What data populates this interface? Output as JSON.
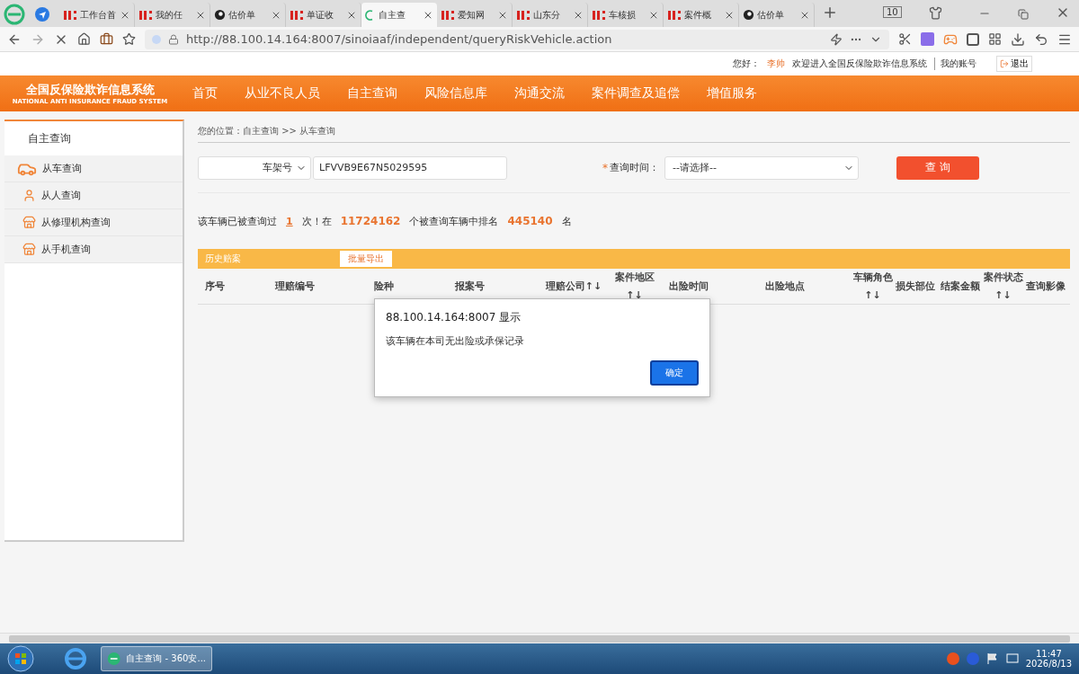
{
  "browser": {
    "tabs": [
      {
        "kind": "cic",
        "label": "工作台首",
        "selected": false
      },
      {
        "kind": "cic",
        "label": "我的任",
        "selected": false
      },
      {
        "kind": "calc",
        "label": "估价单",
        "selected": false
      },
      {
        "kind": "cic",
        "label": "单证收",
        "selected": false
      },
      {
        "kind": "loading",
        "label": "自主查",
        "selected": true
      },
      {
        "kind": "cic",
        "label": "爱知网",
        "selected": false
      },
      {
        "kind": "cic",
        "label": "山东分",
        "selected": false
      },
      {
        "kind": "cic",
        "label": "车核损",
        "selected": false
      },
      {
        "kind": "cic",
        "label": "案件概",
        "selected": false
      },
      {
        "kind": "calc",
        "label": "估价单",
        "selected": false
      }
    ],
    "tab_count": "10",
    "address": "http://88.100.14.164:8007/sinoiaaf/independent/queryRiskVehicle.action"
  },
  "header": {
    "greeting": "您好：",
    "user": "李帅",
    "welcome": "欢迎进入全国反保险欺诈信息系统",
    "account": "我的账号",
    "logout": "退出"
  },
  "logo": {
    "title": "全国反保险欺诈信息系统",
    "subtitle": "NATIONAL ANTI INSURANCE FRAUD SYSTEM"
  },
  "nav": [
    "首页",
    "从业不良人员",
    "自主查询",
    "风险信息库",
    "沟通交流",
    "案件调查及追偿",
    "增值服务"
  ],
  "sidebar": {
    "title": "自主查询",
    "items": [
      {
        "kind": "car",
        "label": "从车查询"
      },
      {
        "kind": "person",
        "label": "从人查询"
      },
      {
        "kind": "shop",
        "label": "从修理机构查询"
      },
      {
        "kind": "shop",
        "label": "从手机查询"
      }
    ]
  },
  "breadcrumb": "您的位置：自主查询 >> 从车查询",
  "form": {
    "id_type": "车架号",
    "vin": "LFVVB9E67N5029595",
    "required_mark": "*",
    "time_label": "查询时间：",
    "time_value": "--请选择--",
    "query_button": "查 询"
  },
  "stats": [
    {
      "kind": "plain",
      "text": "该车辆已被查询过"
    },
    {
      "kind": "link",
      "text": "1"
    },
    {
      "kind": "plain",
      "text": "次！在"
    },
    {
      "kind": "number",
      "text": "11724162"
    },
    {
      "kind": "plain",
      "text": "个被查询车辆中排名"
    },
    {
      "kind": "number",
      "text": "445140"
    },
    {
      "kind": "plain",
      "text": "名"
    }
  ],
  "table": {
    "title": "历史赔案",
    "export_button": "批量导出",
    "columns": [
      "序号",
      "理赔编号",
      "险种",
      "报案号",
      "理赔公司↑↓",
      "案件地区↑↓",
      "出险时间",
      "出险地点",
      "车辆角色↑↓",
      "损失部位",
      "结案金额",
      "案件状态↑↓",
      "查询影像"
    ]
  },
  "dialog": {
    "title": "88.100.14.164:8007 显示",
    "message": "该车辆在本司无出险或承保记录",
    "button": "确定"
  },
  "taskbar": {
    "task": "自主查询 - 360安...",
    "time": "11:47",
    "date": "2026/8/13"
  }
}
